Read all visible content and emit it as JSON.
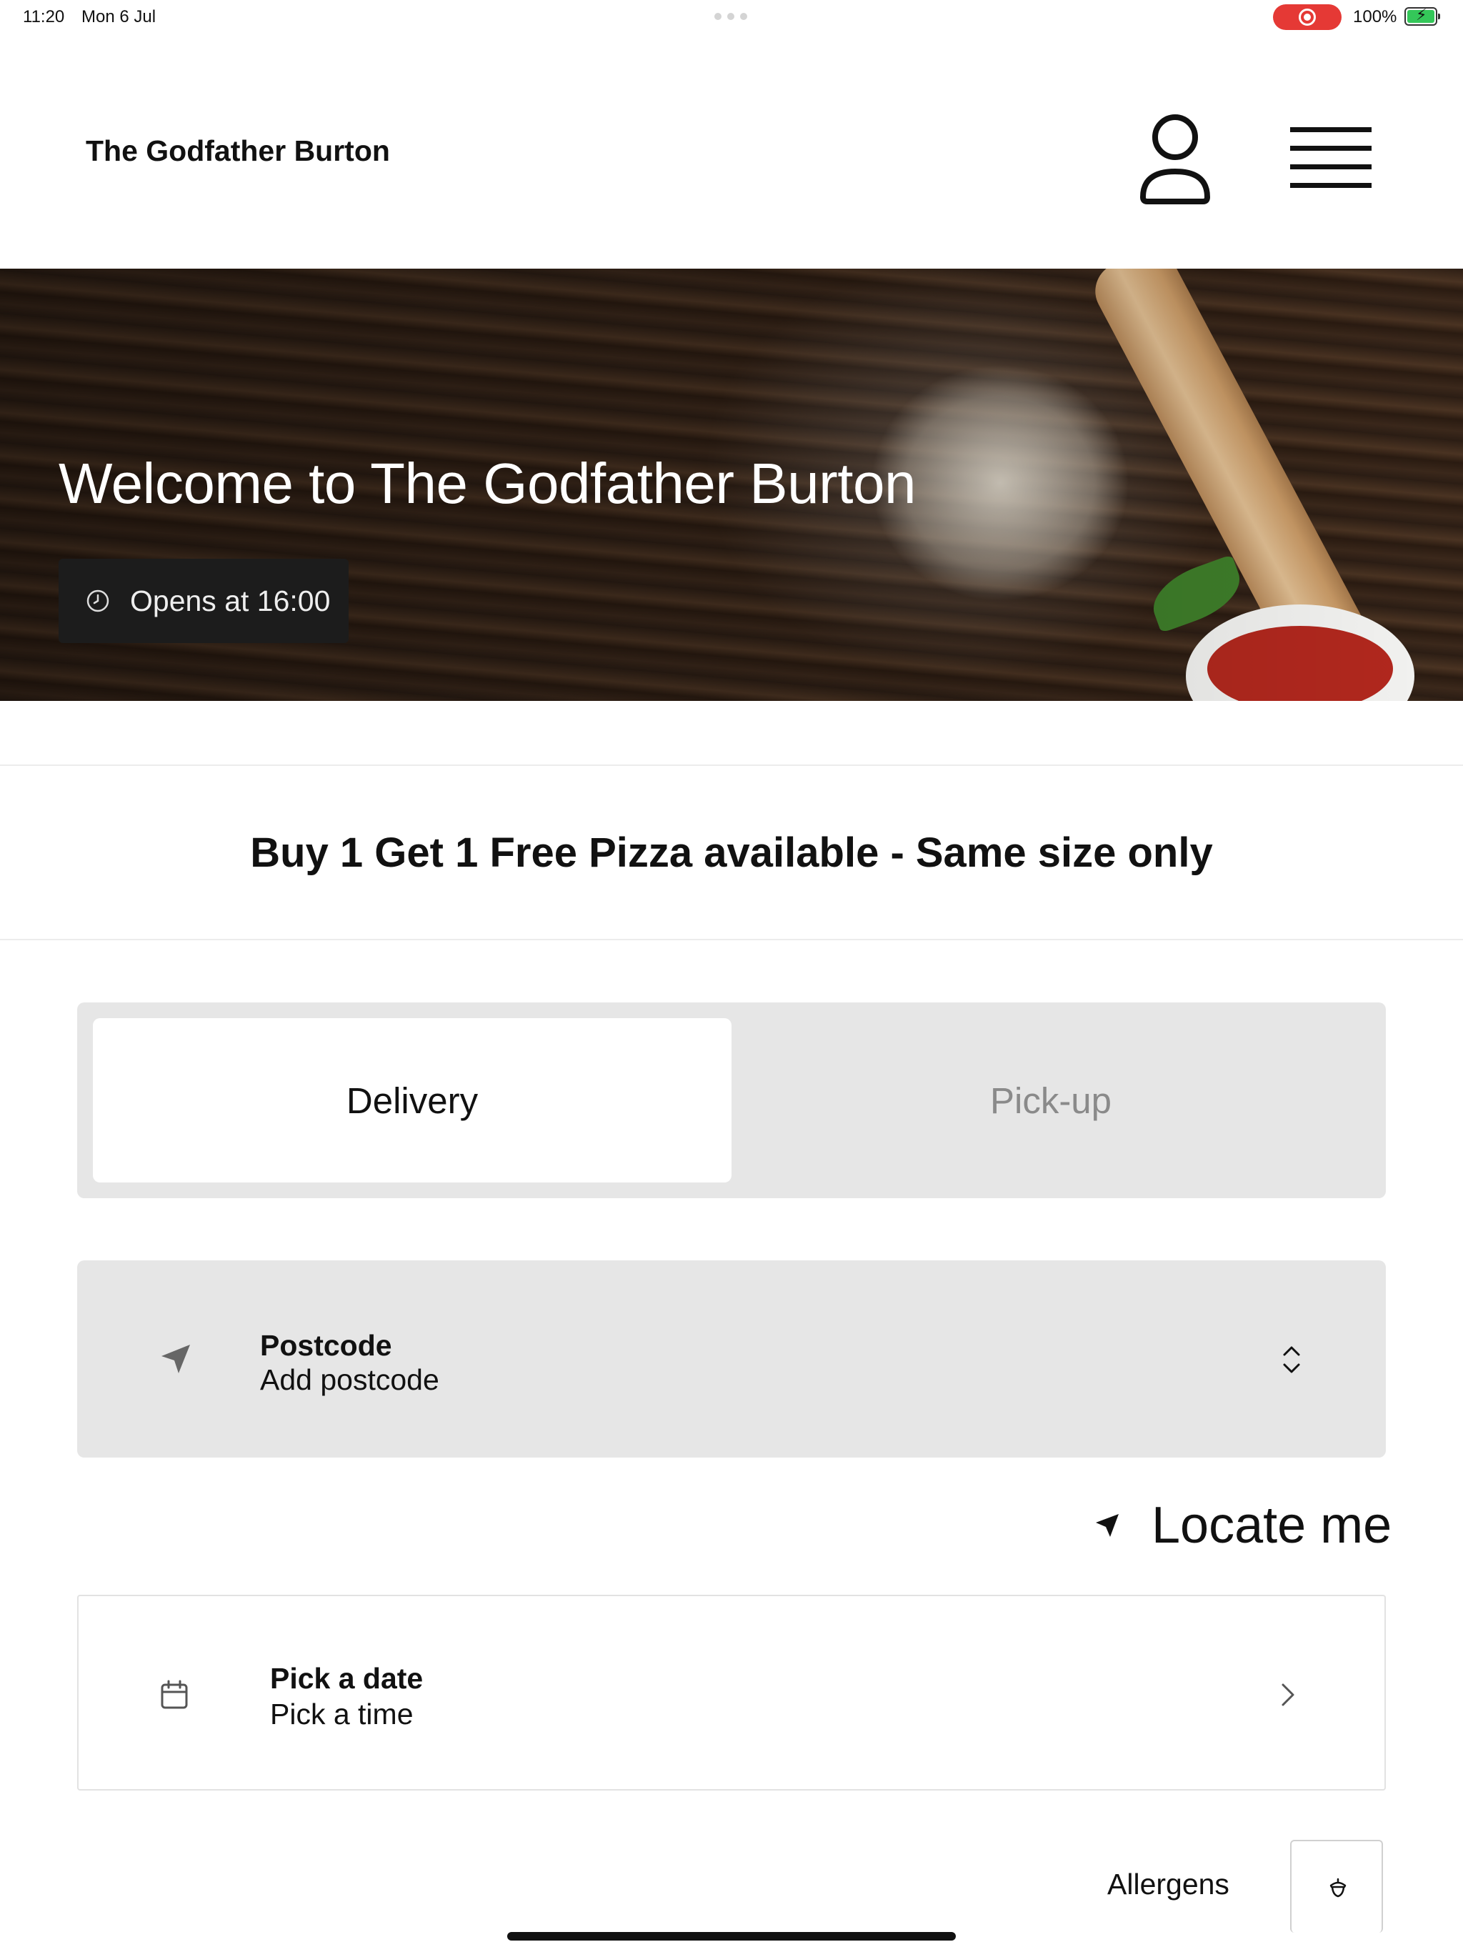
{
  "status_bar": {
    "time": "11:20",
    "date": "Mon 6 Jul",
    "battery_percent": "100%",
    "recording": true,
    "charging": true
  },
  "header": {
    "brand": "The Godfather Burton",
    "user_icon": "user-icon",
    "menu_icon": "hamburger-menu-icon"
  },
  "hero": {
    "title": "Welcome to The Godfather Burton",
    "hours_icon": "clock-icon",
    "hours_text": "Opens at 16:00"
  },
  "promo": {
    "text": "Buy 1 Get 1 Free Pizza available - Same size only"
  },
  "order_mode": {
    "options": [
      "Delivery",
      "Pick-up"
    ],
    "selected": "Delivery"
  },
  "postcode": {
    "icon": "navigation-arrow-icon",
    "label": "Postcode",
    "value": "Add postcode",
    "expand_icon": "chevron-up-down-icon"
  },
  "locate": {
    "icon": "location-arrow-icon",
    "label": "Locate me"
  },
  "schedule": {
    "icon": "calendar-icon",
    "date_label": "Pick a date",
    "time_label": "Pick a time",
    "chevron_icon": "chevron-right-icon"
  },
  "allergens": {
    "label": "Allergens",
    "icon": "acorn-icon"
  },
  "colors": {
    "accent_record": "#e53935",
    "battery": "#34c759",
    "panel_gray": "#e6e6e6",
    "inactive_text": "#8a8a8a"
  }
}
